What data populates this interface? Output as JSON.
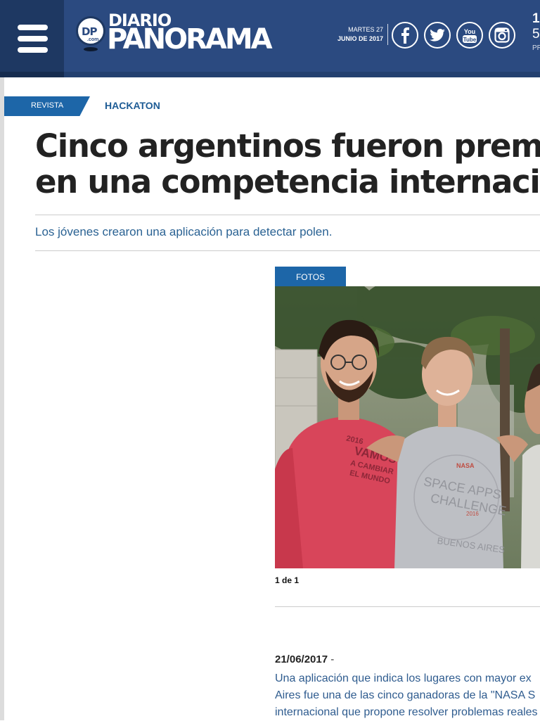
{
  "header": {
    "logo": {
      "badge": "DP",
      "badge_sub": ".com",
      "line1": "DIARIO",
      "line2": "PANORAMA"
    },
    "date": {
      "line1": "MARTES 27",
      "line2": "JUNIO DE 2017"
    },
    "social": [
      {
        "name": "facebook",
        "icon": "facebook-icon"
      },
      {
        "name": "twitter",
        "icon": "twitter-icon"
      },
      {
        "name": "youtube",
        "icon": "youtube-icon",
        "text_top": "You",
        "text_bottom": "Tube"
      },
      {
        "name": "instagram",
        "icon": "instagram-icon"
      }
    ],
    "weather": {
      "line1": "1",
      "line2": "5",
      "line3": "PR"
    },
    "colors": {
      "header_bg": "#2b4a80",
      "menu_bg": "#1e3862",
      "accent": "#1d66a8"
    }
  },
  "breadcrumb": {
    "section": "REVISTA",
    "tag": "HACKATON"
  },
  "article": {
    "headline_line1": "Cinco argentinos fueron premiados",
    "headline_line2": "en una competencia internacional",
    "subtitle": "Los jóvenes crearon una aplicación para detectar polen.",
    "gallery": {
      "tab": "FOTOS",
      "counter": "1 de 1"
    },
    "date": "21/06/2017",
    "date_separator": "-",
    "body_lines": [
      "Una aplicación que indica los lugares con mayor ex",
      "Aires fue una de las cinco ganadoras de la \"NASA S",
      "internacional que propone resolver problemas reales"
    ]
  },
  "photo_shirt_text": {
    "left_shirt": [
      "2016",
      "VAMOS",
      "A CAMBIAR",
      "EL MUNDO"
    ],
    "middle_shirt": [
      "NASA",
      "SPACE APPS",
      "CHALLENGE",
      "2016",
      "BUENOS AIRES"
    ]
  }
}
